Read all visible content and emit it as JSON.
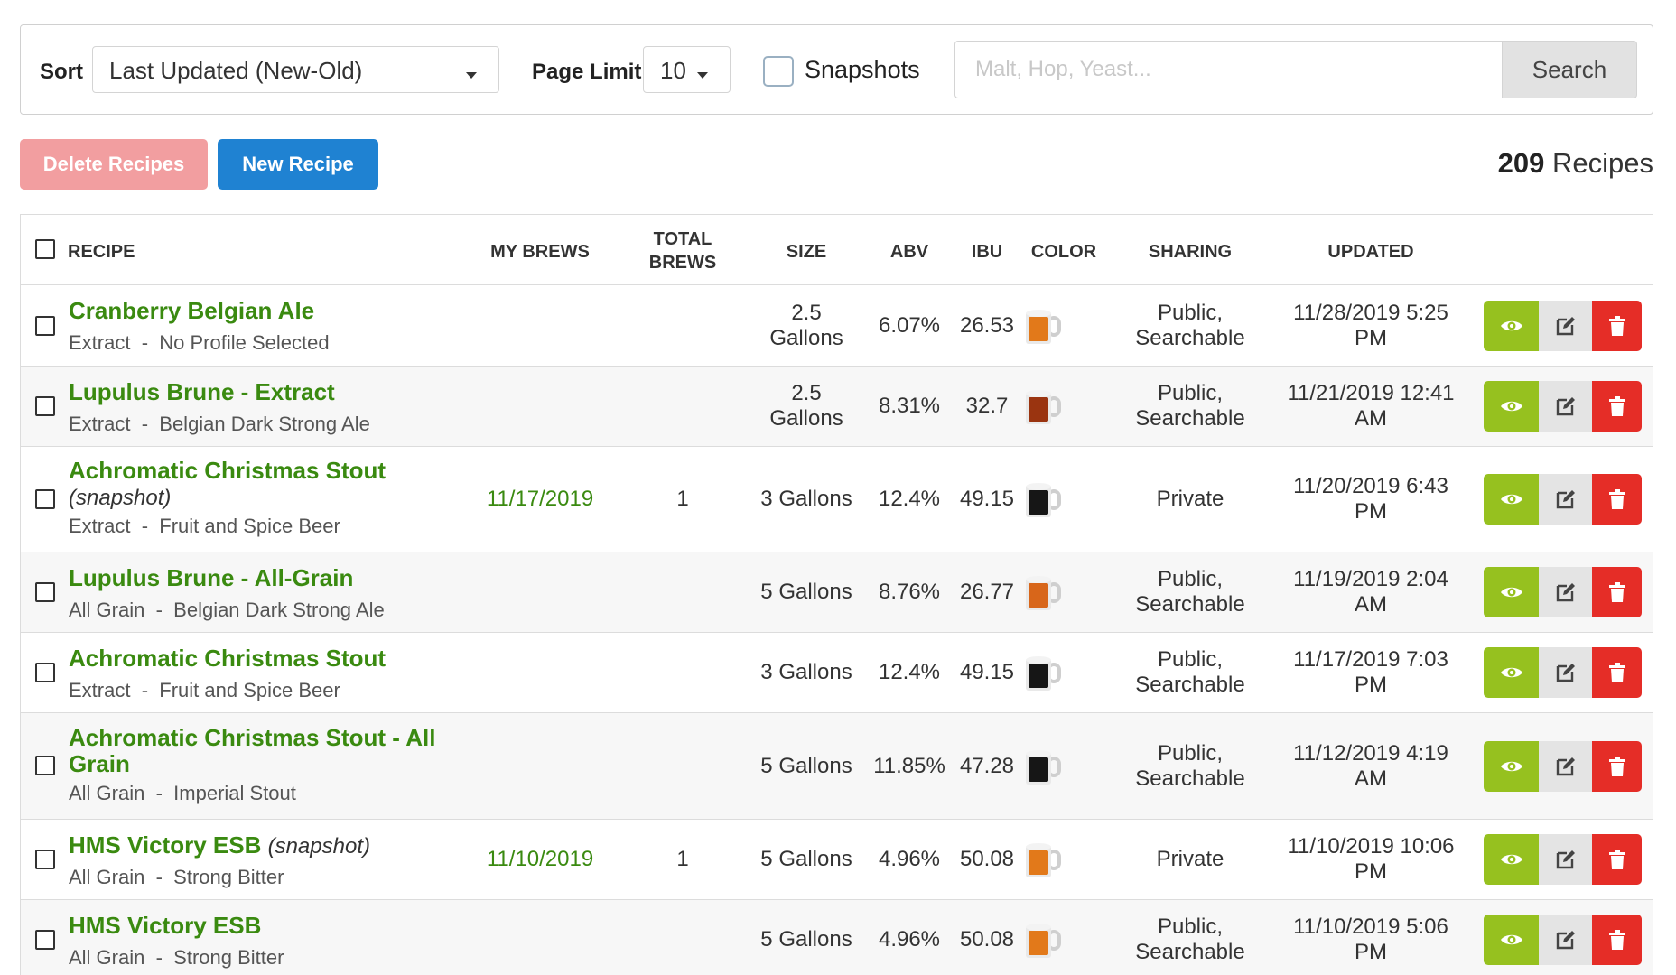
{
  "filters": {
    "sort_label": "Sort",
    "sort_value": "Last Updated (New-Old)",
    "page_limit_label": "Page Limit",
    "page_limit_value": "10",
    "snapshots_label": "Snapshots",
    "snapshots_checked": false,
    "search_placeholder": "Malt, Hop, Yeast...",
    "search_button": "Search"
  },
  "actions": {
    "delete_label": "Delete Recipes",
    "new_label": "New Recipe"
  },
  "count": {
    "number": "209",
    "label": "Recipes"
  },
  "table": {
    "headers": {
      "recipe": "RECIPE",
      "my_brews": "MY BREWS",
      "total_brews_1": "TOTAL",
      "total_brews_2": "BREWS",
      "size": "SIZE",
      "abv": "ABV",
      "ibu": "IBU",
      "color": "COLOR",
      "sharing": "SHARING",
      "updated": "UPDATED"
    },
    "rows": [
      {
        "name": "Cranberry Belgian Ale",
        "snapshot": "",
        "method": "Extract",
        "style": "No Profile Selected",
        "my_brews": "",
        "total_brews": "",
        "size_1": "2.5",
        "size_2": "Gallons",
        "abv": "6.07%",
        "ibu": "26.53",
        "color": "#e2791a",
        "sharing_1": "Public,",
        "sharing_2": "Searchable",
        "updated_1": "11/28/2019 5:25",
        "updated_2": "PM"
      },
      {
        "name": "Lupulus Brune - Extract",
        "snapshot": "",
        "method": "Extract",
        "style": "Belgian Dark Strong Ale",
        "my_brews": "",
        "total_brews": "",
        "size_1": "2.5",
        "size_2": "Gallons",
        "abv": "8.31%",
        "ibu": "32.7",
        "color": "#9a3410",
        "sharing_1": "Public,",
        "sharing_2": "Searchable",
        "updated_1": "11/21/2019 12:41",
        "updated_2": "AM"
      },
      {
        "name_1": "Achromatic Christmas Stout",
        "snapshot": "(snapshot)",
        "method": "Extract",
        "style": "Fruit and Spice Beer",
        "my_brews": "11/17/2019",
        "total_brews": "1",
        "size": "3 Gallons",
        "abv": "12.4%",
        "ibu": "49.15",
        "color": "#161616",
        "sharing": "Private",
        "updated_1": "11/20/2019 6:43",
        "updated_2": "PM"
      },
      {
        "name": "Lupulus Brune - All-Grain",
        "snapshot": "",
        "method": "All Grain",
        "style": "Belgian Dark Strong Ale",
        "my_brews": "",
        "total_brews": "",
        "size": "5 Gallons",
        "abv": "8.76%",
        "ibu": "26.77",
        "color": "#d8661a",
        "sharing_1": "Public,",
        "sharing_2": "Searchable",
        "updated_1": "11/19/2019 2:04",
        "updated_2": "AM"
      },
      {
        "name": "Achromatic Christmas Stout",
        "snapshot": "",
        "method": "Extract",
        "style": "Fruit and Spice Beer",
        "my_brews": "",
        "total_brews": "",
        "size": "3 Gallons",
        "abv": "12.4%",
        "ibu": "49.15",
        "color": "#161616",
        "sharing_1": "Public,",
        "sharing_2": "Searchable",
        "updated_1": "11/17/2019 7:03",
        "updated_2": "PM"
      },
      {
        "name_1": "Achromatic Christmas Stout - All",
        "name_2": "Grain",
        "snapshot": "",
        "method": "All Grain",
        "style": "Imperial Stout",
        "my_brews": "",
        "total_brews": "",
        "size": "5 Gallons",
        "abv": "11.85%",
        "ibu": "47.28",
        "color": "#161616",
        "sharing_1": "Public,",
        "sharing_2": "Searchable",
        "updated_1": "11/12/2019 4:19",
        "updated_2": "AM"
      },
      {
        "name": "HMS Victory ESB",
        "snapshot": "(snapshot)",
        "method": "All Grain",
        "style": "Strong Bitter",
        "my_brews": "11/10/2019",
        "total_brews": "1",
        "size": "5 Gallons",
        "abv": "4.96%",
        "ibu": "50.08",
        "color": "#e2791a",
        "sharing": "Private",
        "updated_1": "11/10/2019 10:06",
        "updated_2": "PM"
      },
      {
        "name": "HMS Victory ESB",
        "snapshot": "",
        "method": "All Grain",
        "style": "Strong Bitter",
        "my_brews": "",
        "total_brews": "",
        "size": "5 Gallons",
        "abv": "4.96%",
        "ibu": "50.08",
        "color": "#e2791a",
        "sharing_1": "Public,",
        "sharing_2": "Searchable",
        "updated_1": "11/10/2019 5:06",
        "updated_2": "PM"
      }
    ],
    "sep": "-"
  },
  "icons": {
    "view": "eye-icon",
    "edit": "edit-icon",
    "delete": "trash-icon",
    "color": "beer-mug-icon"
  },
  "colors": {
    "recipe_link": "#3a8a10",
    "view_button": "#96c11f",
    "delete_button": "#e52d27",
    "new_button": "#1f82d2",
    "delete_recipes_button": "#f29ea0"
  }
}
